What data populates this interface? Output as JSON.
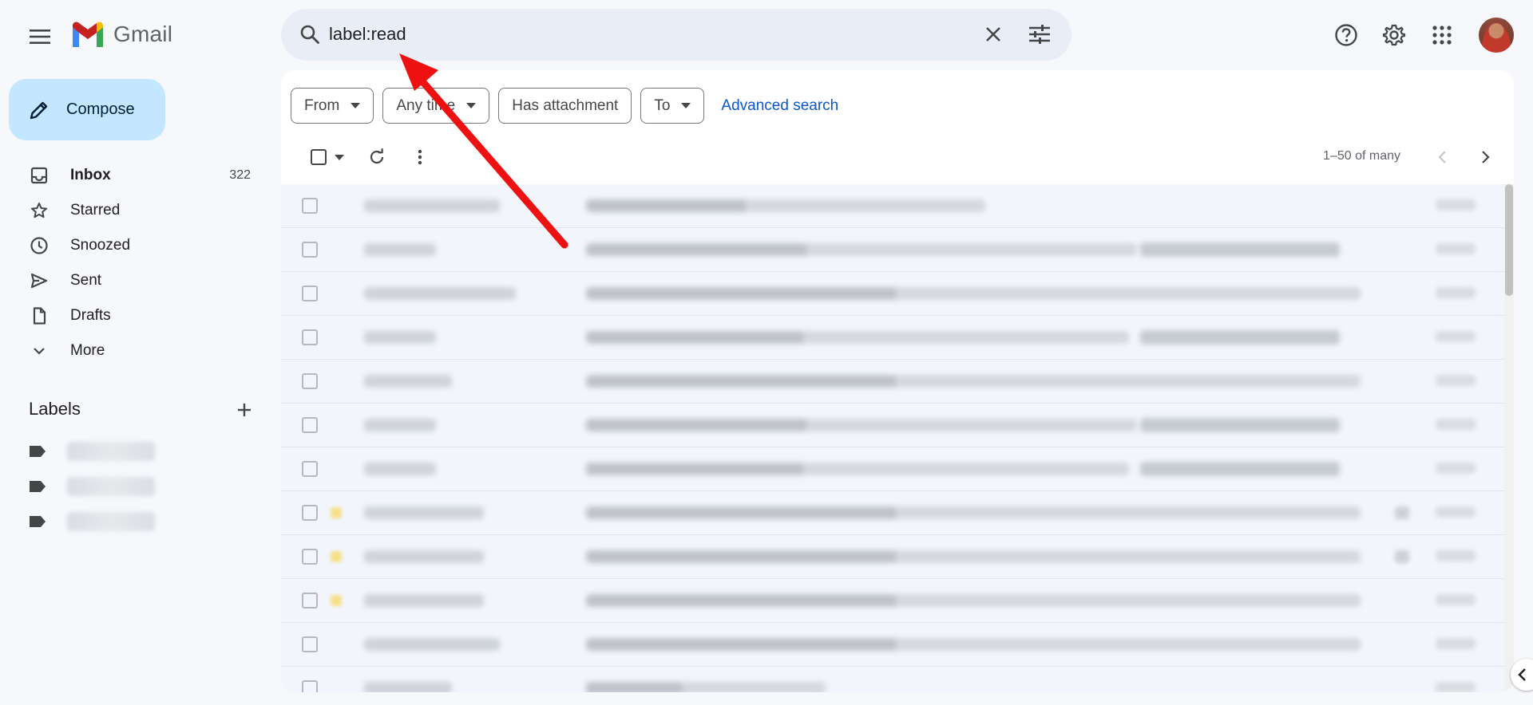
{
  "app": {
    "name": "Gmail"
  },
  "search": {
    "value": "label:read"
  },
  "compose": {
    "label": "Compose"
  },
  "nav": [
    {
      "label": "Inbox",
      "count": "322",
      "icon": "inbox-icon",
      "active": true
    },
    {
      "label": "Starred",
      "count": "",
      "icon": "star-icon",
      "active": false
    },
    {
      "label": "Snoozed",
      "count": "",
      "icon": "clock-icon",
      "active": false
    },
    {
      "label": "Sent",
      "count": "",
      "icon": "send-icon",
      "active": false
    },
    {
      "label": "Drafts",
      "count": "",
      "icon": "draft-icon",
      "active": false
    },
    {
      "label": "More",
      "count": "",
      "icon": "chevron-down-icon",
      "active": false
    }
  ],
  "labels": {
    "title": "Labels"
  },
  "filters": {
    "from": "From",
    "any_time": "Any time",
    "has_attachment": "Has attachment",
    "to": "To",
    "advanced": "Advanced search"
  },
  "toolbar": {
    "pager": "1–50 of many"
  },
  "colors": {
    "brand_red": "#ea4335",
    "accent_blue": "#0b57d0",
    "compose_bg": "#c2e7ff",
    "annotation_arrow": "#ee1111"
  }
}
